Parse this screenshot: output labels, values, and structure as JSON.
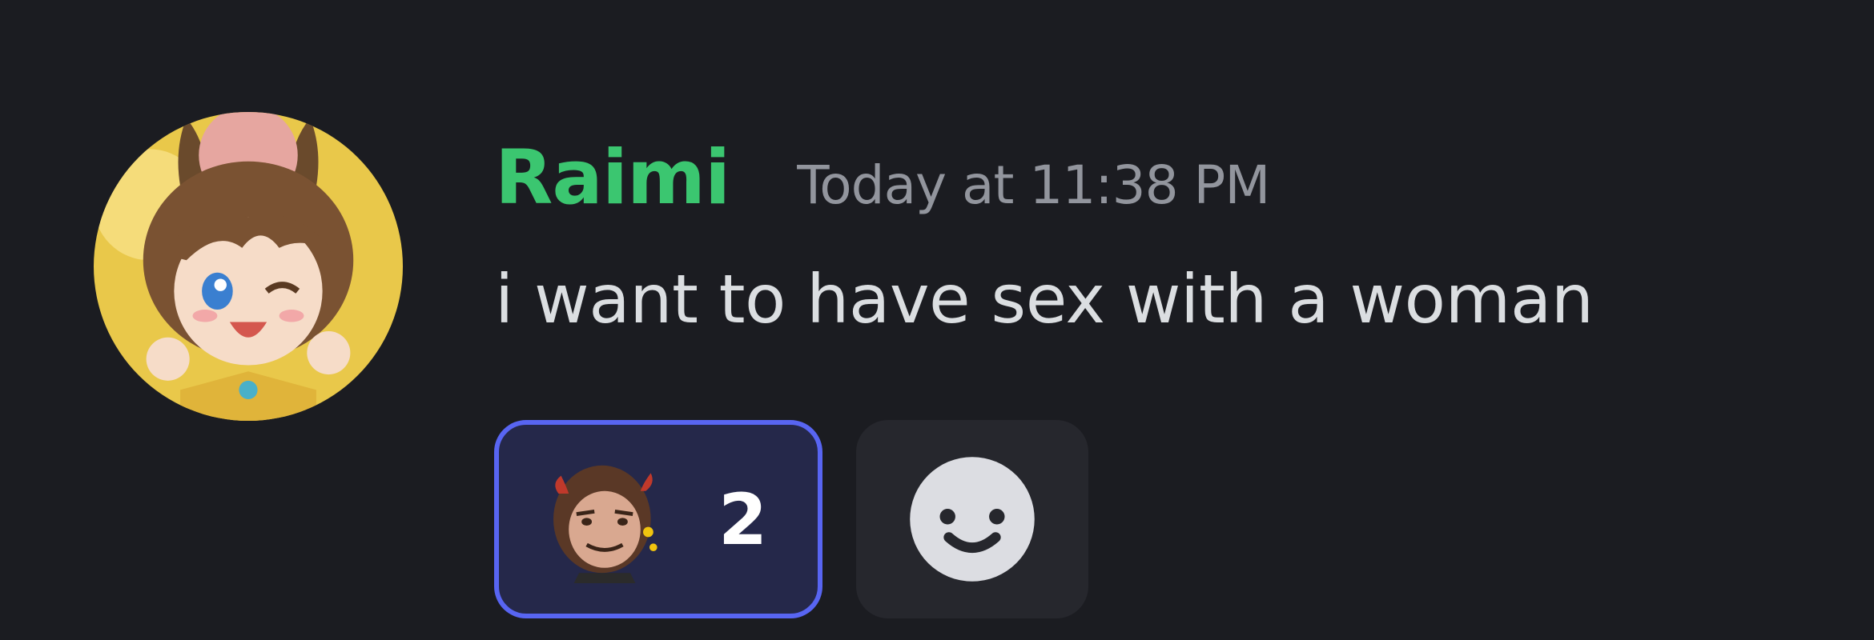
{
  "message": {
    "author": "Raimi",
    "timestamp": "Today at 11:38 PM",
    "content": "i want to have sex with a woman",
    "author_color": "#3bc670"
  },
  "reactions": [
    {
      "emoji": "custom-face-emoji",
      "count": "2",
      "reacted": true
    }
  ],
  "add_reaction": {
    "icon": "smiley-face-icon"
  },
  "colors": {
    "background": "#1b1c21",
    "text": "#dbdee1",
    "muted": "#92959d",
    "reaction_border": "#5865f2",
    "reaction_bg": "#25284a"
  }
}
